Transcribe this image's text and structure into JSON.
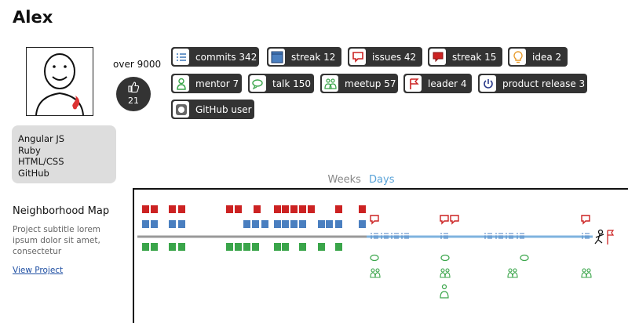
{
  "profile": {
    "name": "Alex",
    "likes_text": "over 9000",
    "likes_count": "21",
    "skills": [
      "Angular JS",
      "Ruby",
      "HTML/CSS",
      "GitHub"
    ]
  },
  "badges": [
    {
      "label": "commits 342",
      "icon": "list-icon",
      "color": "#2f6db3"
    },
    {
      "label": "streak 12",
      "icon": "calendar-icon",
      "color": "#4a7fc0"
    },
    {
      "label": "issues 42",
      "icon": "issue-bubble-icon",
      "color": "#cc2222"
    },
    {
      "label": "streak 15",
      "icon": "issue-streak-icon",
      "color": "#cc2222"
    },
    {
      "label": "idea 2",
      "icon": "lightbulb-icon",
      "color": "#e89a2a"
    },
    {
      "label": "mentor 7",
      "icon": "person-icon",
      "color": "#3aa54a"
    },
    {
      "label": "talk 150",
      "icon": "speech-bubble-icon",
      "color": "#3aa54a"
    },
    {
      "label": "meetup 57",
      "icon": "group-icon",
      "color": "#3aa54a"
    },
    {
      "label": "leader 4",
      "icon": "flag-icon",
      "color": "#cc2222"
    },
    {
      "label": "product release 3",
      "icon": "power-icon",
      "color": "#2a3a8a"
    },
    {
      "label": "GitHub user",
      "icon": "github-icon",
      "color": "#666666"
    }
  ],
  "tabs": {
    "weeks": "Weeks",
    "days": "Days",
    "active": "days"
  },
  "project": {
    "title": "Neighborhood Map",
    "subtitle": "Project subtitle lorem ipsum dolor sit amet, consectetur",
    "link_text": "View Project"
  },
  "timeline": {
    "colors": {
      "issues": "#cc2222",
      "commits": "#4a7fc0",
      "talks": "#3aa54a",
      "past_line": "#999999",
      "future_line": "#7fb3df"
    }
  }
}
